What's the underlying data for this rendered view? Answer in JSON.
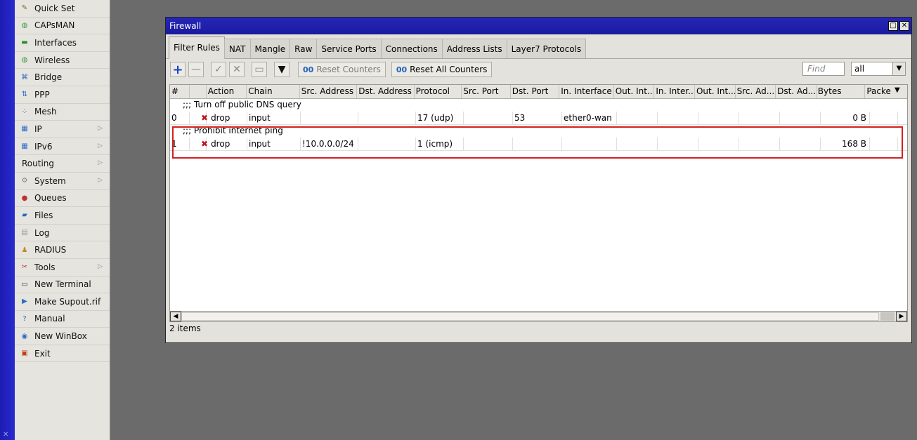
{
  "sidebar": {
    "items": [
      {
        "label": "Quick Set",
        "icon": "quickset-icon",
        "sub": false
      },
      {
        "label": "CAPsMAN",
        "icon": "capsman-icon",
        "sub": false
      },
      {
        "label": "Interfaces",
        "icon": "interfaces-icon",
        "sub": false
      },
      {
        "label": "Wireless",
        "icon": "wireless-icon",
        "sub": false
      },
      {
        "label": "Bridge",
        "icon": "bridge-icon",
        "sub": false
      },
      {
        "label": "PPP",
        "icon": "ppp-icon",
        "sub": false
      },
      {
        "label": "Mesh",
        "icon": "mesh-icon",
        "sub": false
      },
      {
        "label": "IP",
        "icon": "ip-icon",
        "sub": true
      },
      {
        "label": "IPv6",
        "icon": "ipv6-icon",
        "sub": true
      },
      {
        "label": "Routing",
        "icon": "",
        "sub": true
      },
      {
        "label": "System",
        "icon": "system-icon",
        "sub": true
      },
      {
        "label": "Queues",
        "icon": "queues-icon",
        "sub": false
      },
      {
        "label": "Files",
        "icon": "files-icon",
        "sub": false
      },
      {
        "label": "Log",
        "icon": "log-icon",
        "sub": false
      },
      {
        "label": "RADIUS",
        "icon": "radius-icon",
        "sub": false
      },
      {
        "label": "Tools",
        "icon": "tools-icon",
        "sub": true
      },
      {
        "label": "New Terminal",
        "icon": "terminal-icon",
        "sub": false
      },
      {
        "label": "Make Supout.rif",
        "icon": "supout-icon",
        "sub": false
      },
      {
        "label": "Manual",
        "icon": "manual-icon",
        "sub": false
      },
      {
        "label": "New WinBox",
        "icon": "winbox-icon",
        "sub": false
      },
      {
        "label": "Exit",
        "icon": "exit-icon",
        "sub": false
      }
    ]
  },
  "window": {
    "title": "Firewall",
    "tabs": [
      "Filter Rules",
      "NAT",
      "Mangle",
      "Raw",
      "Service Ports",
      "Connections",
      "Address Lists",
      "Layer7 Protocols"
    ],
    "active_tab": "Filter Rules",
    "toolbar": {
      "reset_counters": "Reset Counters",
      "reset_all_counters": "Reset All Counters",
      "find_placeholder": "Find",
      "find_scope": "all"
    },
    "columns": [
      "#",
      "",
      "Action",
      "Chain",
      "Src. Address",
      "Dst. Address",
      "Protocol",
      "Src. Port",
      "Dst. Port",
      "In. Interface",
      "Out. Int...",
      "In. Inter...",
      "Out. Int...",
      "Src. Ad...",
      "Dst. Ad...",
      "Bytes",
      "Packe"
    ],
    "rules": [
      {
        "comment": ";;; Turn off public DNS query",
        "cells": [
          "0",
          "",
          "drop",
          "input",
          "",
          "",
          "17 (udp)",
          "",
          "53",
          "ether0-wan",
          "",
          "",
          "",
          "",
          "",
          "0 B",
          ""
        ]
      },
      {
        "comment": ";;; Prohibit internet ping",
        "cells": [
          "1",
          "",
          "drop",
          "input",
          "!10.0.0.0/24",
          "",
          "1 (icmp)",
          "",
          "",
          "",
          "",
          "",
          "",
          "",
          "",
          "168 B",
          ""
        ]
      }
    ],
    "status": "2 items"
  },
  "colors": {
    "titlebar": "#1e1eaa",
    "highlight": "#d42020",
    "drop_icon": "#c0161e"
  }
}
